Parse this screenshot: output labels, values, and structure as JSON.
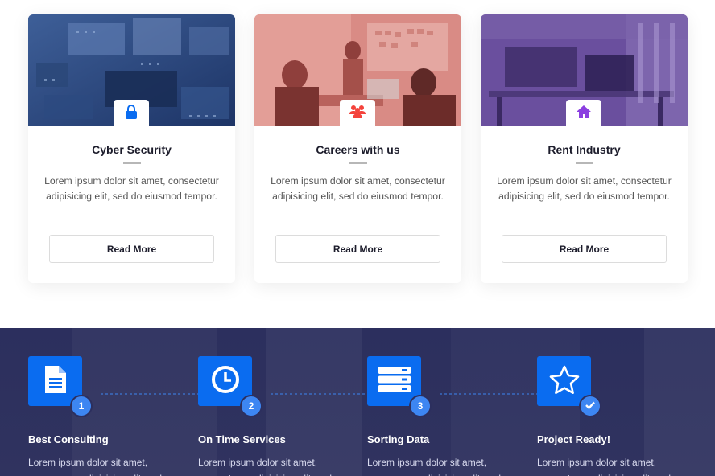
{
  "services": [
    {
      "title": "Cyber Security",
      "icon": "lock-icon",
      "icon_color": "#0a6cf0",
      "text": "Lorem ipsum dolor sit amet, consectetur adipisicing elit, sed do eiusmod tempor.",
      "button": "Read More"
    },
    {
      "title": "Careers with us",
      "icon": "users-icon",
      "icon_color": "#f4433c",
      "text": "Lorem ipsum dolor sit amet, consectetur adipisicing elit, sed do eiusmod tempor.",
      "button": "Read More"
    },
    {
      "title": "Rent Industry",
      "icon": "home-icon",
      "icon_color": "#8b3fe0",
      "text": "Lorem ipsum dolor sit amet, consectetur adipisicing elit, sed do eiusmod tempor.",
      "button": "Read More"
    }
  ],
  "process": [
    {
      "number": "1",
      "icon": "document-icon",
      "title": "Best Consulting",
      "text": "Lorem ipsum dolor sit amet, consectetur adipisicing elit, sed"
    },
    {
      "number": "2",
      "icon": "clock-icon",
      "title": "On Time Services",
      "text": "Lorem ipsum dolor sit amet, consectetur adipisicing elit, sed"
    },
    {
      "number": "3",
      "icon": "server-icon",
      "title": "Sorting Data",
      "text": "Lorem ipsum dolor sit amet, consectetur adipisicing elit, sed"
    },
    {
      "number": "",
      "badge_icon": "check-icon",
      "icon": "star-icon",
      "title": "Project Ready!",
      "text": "Lorem ipsum dolor sit amet, consectetur adipisicing elit, sed"
    }
  ],
  "colors": {
    "accent": "#0a6cf0",
    "dark_section": "#2c2f5e"
  }
}
